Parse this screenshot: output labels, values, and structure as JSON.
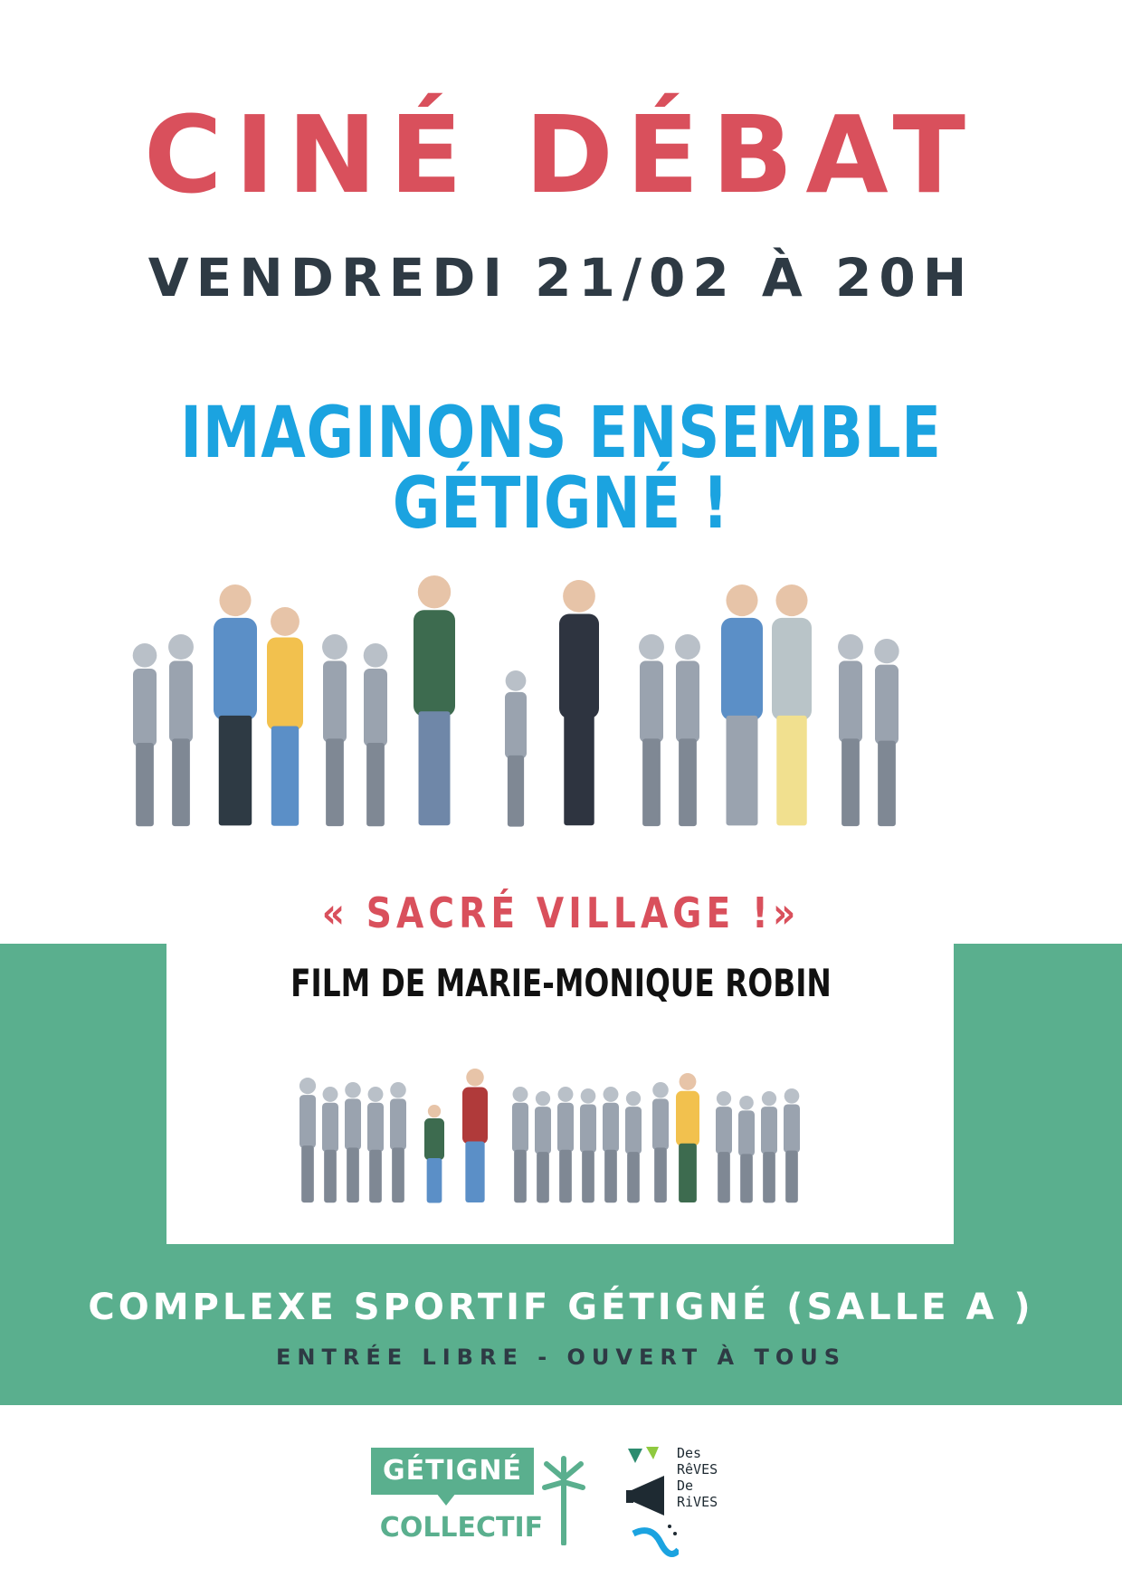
{
  "header": {
    "title": "CINÉ DÉBAT",
    "date": "VENDREDI 21/02 À 20H"
  },
  "slogan": "IMAGINONS ENSEMBLE GÉTIGNÉ !",
  "film": {
    "title": "« SACRÉ VILLAGE !»",
    "author": "FILM DE MARIE-MONIQUE ROBIN"
  },
  "venue": {
    "name": "COMPLEXE SPORTIF GÉTIGNÉ (SALLE A )",
    "access": "ENTRÉE LIBRE - OUVERT À TOUS"
  },
  "logos": {
    "getigne_top": "GÉTIGNÉ",
    "getigne_bottom": "COLLECTIF",
    "reves_line1": "Des",
    "reves_line2": "RêVES",
    "reves_line3": "De",
    "reves_line4": "RiVES"
  },
  "colors": {
    "accent_red": "#d9505c",
    "accent_blue": "#1ba3e0",
    "band_green": "#5aaf8e",
    "dark_text": "#2e3a44"
  }
}
